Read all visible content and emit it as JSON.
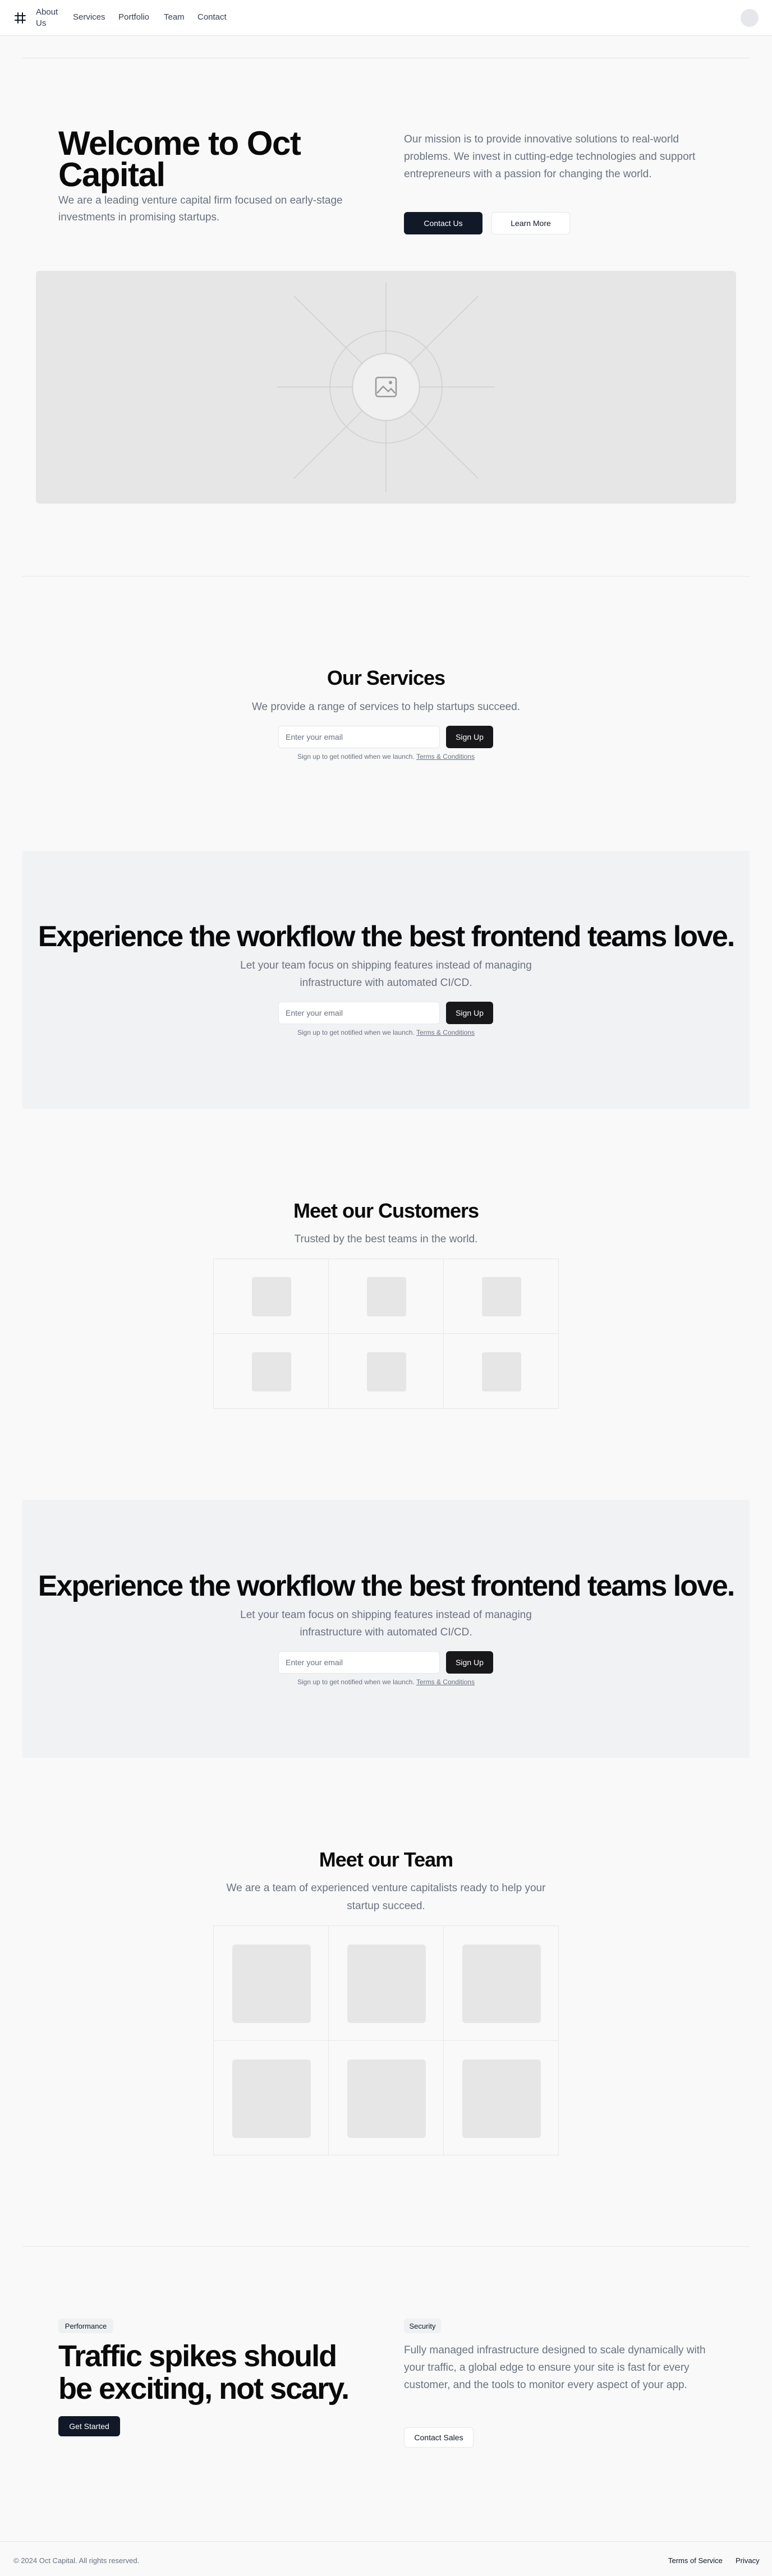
{
  "nav": {
    "links": [
      "About Us",
      "Services",
      "Portfolio",
      "Team",
      "Contact"
    ]
  },
  "hero": {
    "title": "Welcome to Oct Capital",
    "subtitle": "We are a leading venture capital firm focused on early-stage investments in promising startups.",
    "mission": "Our mission is to provide innovative solutions to real-world problems. We invest in cutting-edge technologies and support entrepreneurs with a passion for changing the world.",
    "contact_label": "Contact Us",
    "learn_label": "Learn More"
  },
  "services": {
    "title": "Our Services",
    "subtitle": "We provide a range of services to help startups succeed.",
    "email_placeholder": "Enter your email",
    "signup_label": "Sign Up",
    "fine_prefix": "Sign up to get notified when we launch.",
    "terms_label": "Terms & Conditions"
  },
  "cta1": {
    "title": "Experience the workflow the best frontend teams love.",
    "subtitle": "Let your team focus on shipping features instead of managing infrastructure with automated CI/CD.",
    "email_placeholder": "Enter your email",
    "signup_label": "Sign Up",
    "fine_prefix": "Sign up to get notified when we launch.",
    "terms_label": "Terms & Conditions"
  },
  "customers": {
    "title": "Meet our Customers",
    "subtitle": "Trusted by the best teams in the world."
  },
  "cta2": {
    "title": "Experience the workflow the best frontend teams love.",
    "subtitle": "Let your team focus on shipping features instead of managing infrastructure with automated CI/CD.",
    "email_placeholder": "Enter your email",
    "signup_label": "Sign Up",
    "fine_prefix": "Sign up to get notified when we launch.",
    "terms_label": "Terms & Conditions"
  },
  "team": {
    "title": "Meet our Team",
    "subtitle": "We are a team of experienced venture capitalists ready to help your startup succeed."
  },
  "performance": {
    "badge": "Performance",
    "title": "Traffic spikes should be exciting, not scary.",
    "cta_label": "Get Started",
    "security_badge": "Security",
    "description": "Fully managed infrastructure designed to scale dynamically with your traffic, a global edge to ensure your site is fast for every customer, and the tools to monitor every aspect of your app.",
    "sales_label": "Contact Sales"
  },
  "footer": {
    "copyright": "© 2024 Oct Capital. All rights reserved.",
    "terms": "Terms of Service",
    "privacy": "Privacy"
  }
}
